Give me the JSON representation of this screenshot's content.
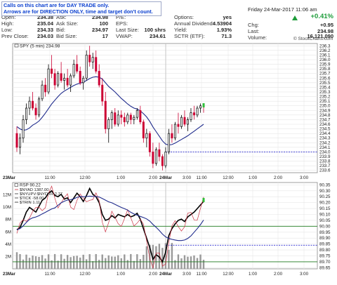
{
  "notice": {
    "line1": "Calls on this chart are for DAY TRADE only.",
    "line2": "Arrows are for DIRECTION ONLY, time and target don't count."
  },
  "quote": {
    "date_time": "Friday  24-Mar-2017  11:06 am",
    "rows": [
      {
        "open_label": "Open:",
        "open": "234.38",
        "ask_label": "Ask:",
        "ask": "234.98",
        "pe_label": "P/E:",
        "pe": "",
        "options_label": "Options:",
        "options": "yes"
      },
      {
        "open_label": "High:",
        "open": "235.04",
        "ask_label": "Ask Size:",
        "ask": "100",
        "pe_label": "EPS:",
        "pe": "",
        "options_label": "Annual Dividend:",
        "options": "4.53904"
      },
      {
        "open_label": "Low:",
        "open": "234.33",
        "ask_label": "Bid:",
        "ask": "234.97",
        "pe_label": "Last Size:",
        "pe": "100 shrs",
        "options_label": "Yield:",
        "options": "1.93%"
      },
      {
        "open_label": "Prev Close:",
        "open": "234.03",
        "ask_label": "Bid Size:",
        "ask": "17",
        "pe_label": "VWAP:",
        "pe": "234.61",
        "options_label": "SCTR (ETF):",
        "options": "71.3"
      }
    ],
    "change_pct": "+0.41%",
    "chg_label": "Chg:",
    "chg": "+0.95",
    "last_label": "Last:",
    "last": "234.98",
    "volume_label": "Volume:",
    "volume": "16,121,090",
    "arrow_color": "#1e9c3a"
  },
  "watermark": "© StockCharts.com",
  "chart_data": [
    {
      "type": "candlestick",
      "title": "SPY (5 min) 234.98",
      "y_ticks": [
        "236.3",
        "236.2",
        "236.1",
        "236.0",
        "235.9",
        "235.8",
        "235.7",
        "235.6",
        "235.5",
        "235.4",
        "235.3",
        "235.2",
        "235.1",
        "235.0",
        "234.9",
        "234.8",
        "234.7",
        "234.6",
        "234.5",
        "234.4",
        "234.3",
        "234.2",
        "234.1",
        "234.0",
        "233.9",
        "233.8",
        "233.7",
        "233.6"
      ],
      "ylim": [
        233.55,
        236.35
      ],
      "x_ticks": [
        "23Mar",
        "11:00",
        "12:00",
        "1:00",
        "2:00",
        "3:00",
        "24Mar",
        "11:00",
        "12:00",
        "1:00",
        "2:00",
        "3:00"
      ],
      "support_line": 234.0,
      "colors": {
        "up": "#000000",
        "down": "#cc0033",
        "ma": "#1f2b8c",
        "support": "#2b2bd1"
      },
      "candles": [
        [
          234.4,
          234.55,
          234.0,
          234.1
        ],
        [
          234.1,
          234.4,
          233.95,
          234.3
        ],
        [
          234.3,
          234.8,
          234.2,
          234.7
        ],
        [
          234.7,
          235.05,
          234.6,
          234.95
        ],
        [
          234.95,
          235.2,
          234.8,
          235.1
        ],
        [
          235.1,
          235.3,
          234.9,
          234.95
        ],
        [
          234.95,
          235.05,
          234.7,
          234.8
        ],
        [
          234.8,
          235.2,
          234.75,
          235.15
        ],
        [
          235.15,
          235.55,
          235.1,
          235.45
        ],
        [
          235.45,
          235.6,
          235.2,
          235.3
        ],
        [
          235.3,
          235.9,
          235.25,
          235.8
        ],
        [
          235.8,
          236.1,
          235.6,
          235.7
        ],
        [
          235.7,
          235.8,
          235.35,
          235.45
        ],
        [
          235.45,
          235.75,
          235.4,
          235.7
        ],
        [
          235.7,
          235.95,
          235.5,
          235.55
        ],
        [
          235.55,
          235.7,
          235.35,
          235.6
        ],
        [
          235.6,
          235.8,
          235.4,
          235.45
        ],
        [
          235.45,
          235.7,
          235.3,
          235.65
        ],
        [
          235.65,
          236.0,
          235.6,
          235.9
        ],
        [
          235.9,
          236.1,
          235.7,
          235.75
        ],
        [
          235.75,
          235.85,
          235.45,
          235.5
        ],
        [
          235.5,
          235.65,
          235.35,
          235.6
        ],
        [
          235.6,
          236.2,
          235.55,
          236.1
        ],
        [
          236.1,
          236.3,
          235.85,
          235.95
        ],
        [
          235.95,
          236.15,
          235.8,
          236.05
        ],
        [
          236.05,
          236.2,
          235.7,
          235.75
        ],
        [
          235.75,
          235.9,
          235.4,
          235.45
        ],
        [
          235.45,
          235.6,
          235.0,
          235.1
        ],
        [
          235.1,
          235.3,
          234.4,
          234.5
        ],
        [
          234.5,
          234.75,
          234.2,
          234.7
        ],
        [
          234.7,
          234.9,
          234.5,
          234.85
        ],
        [
          234.85,
          234.95,
          234.55,
          234.6
        ],
        [
          234.6,
          234.9,
          234.55,
          234.8
        ],
        [
          234.8,
          234.9,
          234.6,
          234.75
        ],
        [
          234.75,
          234.85,
          234.55,
          234.65
        ],
        [
          234.65,
          234.85,
          234.6,
          234.8
        ],
        [
          234.8,
          234.85,
          234.6,
          234.7
        ],
        [
          234.7,
          234.8,
          234.6,
          234.75
        ],
        [
          234.75,
          234.95,
          234.7,
          234.9
        ],
        [
          234.9,
          235.0,
          234.6,
          234.65
        ],
        [
          234.65,
          234.7,
          234.2,
          234.3
        ],
        [
          234.3,
          234.5,
          234.1,
          234.4
        ],
        [
          234.4,
          234.45,
          233.9,
          234.0
        ],
        [
          234.0,
          234.2,
          233.65,
          233.75
        ],
        [
          233.75,
          234.1,
          233.7,
          234.05
        ],
        [
          234.05,
          234.2,
          233.8,
          233.9
        ],
        [
          233.9,
          233.95,
          233.6,
          233.7
        ],
        [
          233.7,
          234.1,
          233.65,
          234.0
        ],
        [
          234.0,
          234.5,
          233.95,
          234.4
        ],
        [
          234.4,
          234.6,
          234.2,
          234.3
        ],
        [
          234.3,
          234.65,
          234.25,
          234.6
        ],
        [
          234.6,
          234.85,
          234.4,
          234.55
        ],
        [
          234.55,
          234.8,
          234.5,
          234.75
        ],
        [
          234.75,
          234.9,
          234.55,
          234.6
        ],
        [
          234.6,
          234.75,
          234.45,
          234.7
        ],
        [
          234.7,
          234.95,
          234.65,
          234.85
        ],
        [
          234.85,
          235.0,
          234.7,
          234.8
        ],
        [
          234.8,
          235.0,
          234.75,
          234.95
        ],
        [
          234.95,
          235.05,
          234.85,
          235.0
        ],
        [
          235.0,
          235.04,
          234.85,
          234.98
        ]
      ],
      "ma": [
        234.55,
        234.5,
        234.47,
        234.48,
        234.52,
        234.58,
        234.62,
        234.67,
        234.75,
        234.84,
        234.94,
        235.04,
        235.12,
        235.2,
        235.27,
        235.32,
        235.36,
        235.4,
        235.44,
        235.47,
        235.49,
        235.51,
        235.55,
        235.59,
        235.62,
        235.63,
        235.62,
        235.58,
        235.5,
        235.42,
        235.36,
        235.3,
        235.23,
        235.16,
        235.1,
        235.04,
        234.99,
        234.95,
        234.93,
        234.89,
        234.83,
        234.76,
        234.66,
        234.54,
        234.44,
        234.34,
        234.24,
        234.17,
        234.15,
        234.16,
        234.19,
        234.23,
        234.27,
        234.31,
        234.35,
        234.4,
        234.45,
        234.5,
        234.55,
        234.6
      ]
    },
    {
      "type": "line",
      "title": "RSP 90.22",
      "legend": [
        "$NYAD 1387.00",
        "$NYUPV:$NYDNV 2.77",
        "$TICK -58.00",
        "$TRIN 1.11"
      ],
      "y_ticks_right": [
        "90.35",
        "90.30",
        "90.25",
        "90.20",
        "90.15",
        "90.10",
        "90.05",
        "90.00",
        "89.95",
        "89.90",
        "89.85",
        "89.80",
        "89.75",
        "89.70",
        "89.65"
      ],
      "ylim": [
        89.64,
        90.37
      ],
      "y_ticks_left": [
        "12M",
        "10M",
        "8M",
        "6M",
        "4M",
        "2M"
      ],
      "vol_lim": [
        0,
        14
      ],
      "x_ticks": [
        "23Mar",
        "11:00",
        "12:00",
        "1:00",
        "2:00",
        "3:00",
        "24Mar",
        "11:00",
        "12:00",
        "1:00",
        "2:00",
        "3:00"
      ],
      "hlines": [
        90.0,
        89.7
      ],
      "dashed_line": 89.84,
      "colors": {
        "ma": "#1f2b8c",
        "nyad": "#cc3344",
        "bars": "#9a9a9a",
        "hline": "#1e7a1e",
        "dashed": "#2b2bd1"
      }
    }
  ]
}
